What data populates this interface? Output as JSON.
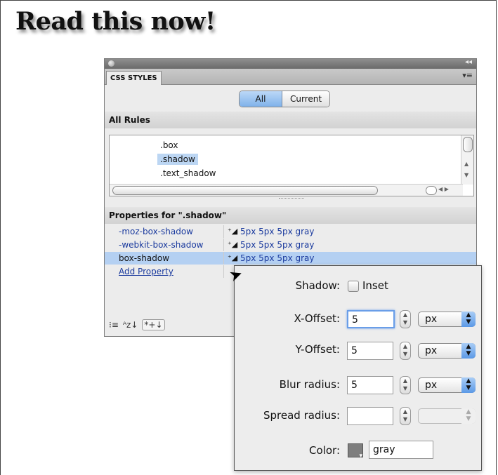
{
  "heading": "Read this now!",
  "panel": {
    "tab": "CSS STYLES",
    "view_toggle": {
      "all": "All",
      "current": "Current"
    },
    "all_rules_header": "All Rules",
    "rules": [
      {
        "name": ".box",
        "selected": false
      },
      {
        "name": ".shadow",
        "selected": true
      },
      {
        "name": ".text_shadow",
        "selected": false
      }
    ],
    "properties_header": "Properties for \".shadow\"",
    "properties": [
      {
        "name": "-moz-box-shadow",
        "value": "5px 5px 5px gray"
      },
      {
        "name": "-webkit-box-shadow",
        "value": "5px 5px 5px gray"
      },
      {
        "name": "box-shadow",
        "value": "5px 5px 5px gray"
      }
    ],
    "add_property": "Add Property",
    "footer": {
      "category_view": "⁝≡",
      "alpha_view": "ᴬz↓",
      "set_only": "*+↓"
    }
  },
  "popup": {
    "shadow_label": "Shadow:",
    "inset_label": "Inset",
    "x_offset_label": "X-Offset:",
    "x_offset_value": "5",
    "y_offset_label": "Y-Offset:",
    "y_offset_value": "5",
    "blur_label": "Blur radius:",
    "blur_value": "5",
    "spread_label": "Spread radius:",
    "spread_value": "",
    "unit_px": "px",
    "color_label": "Color:",
    "color_value": "gray"
  }
}
